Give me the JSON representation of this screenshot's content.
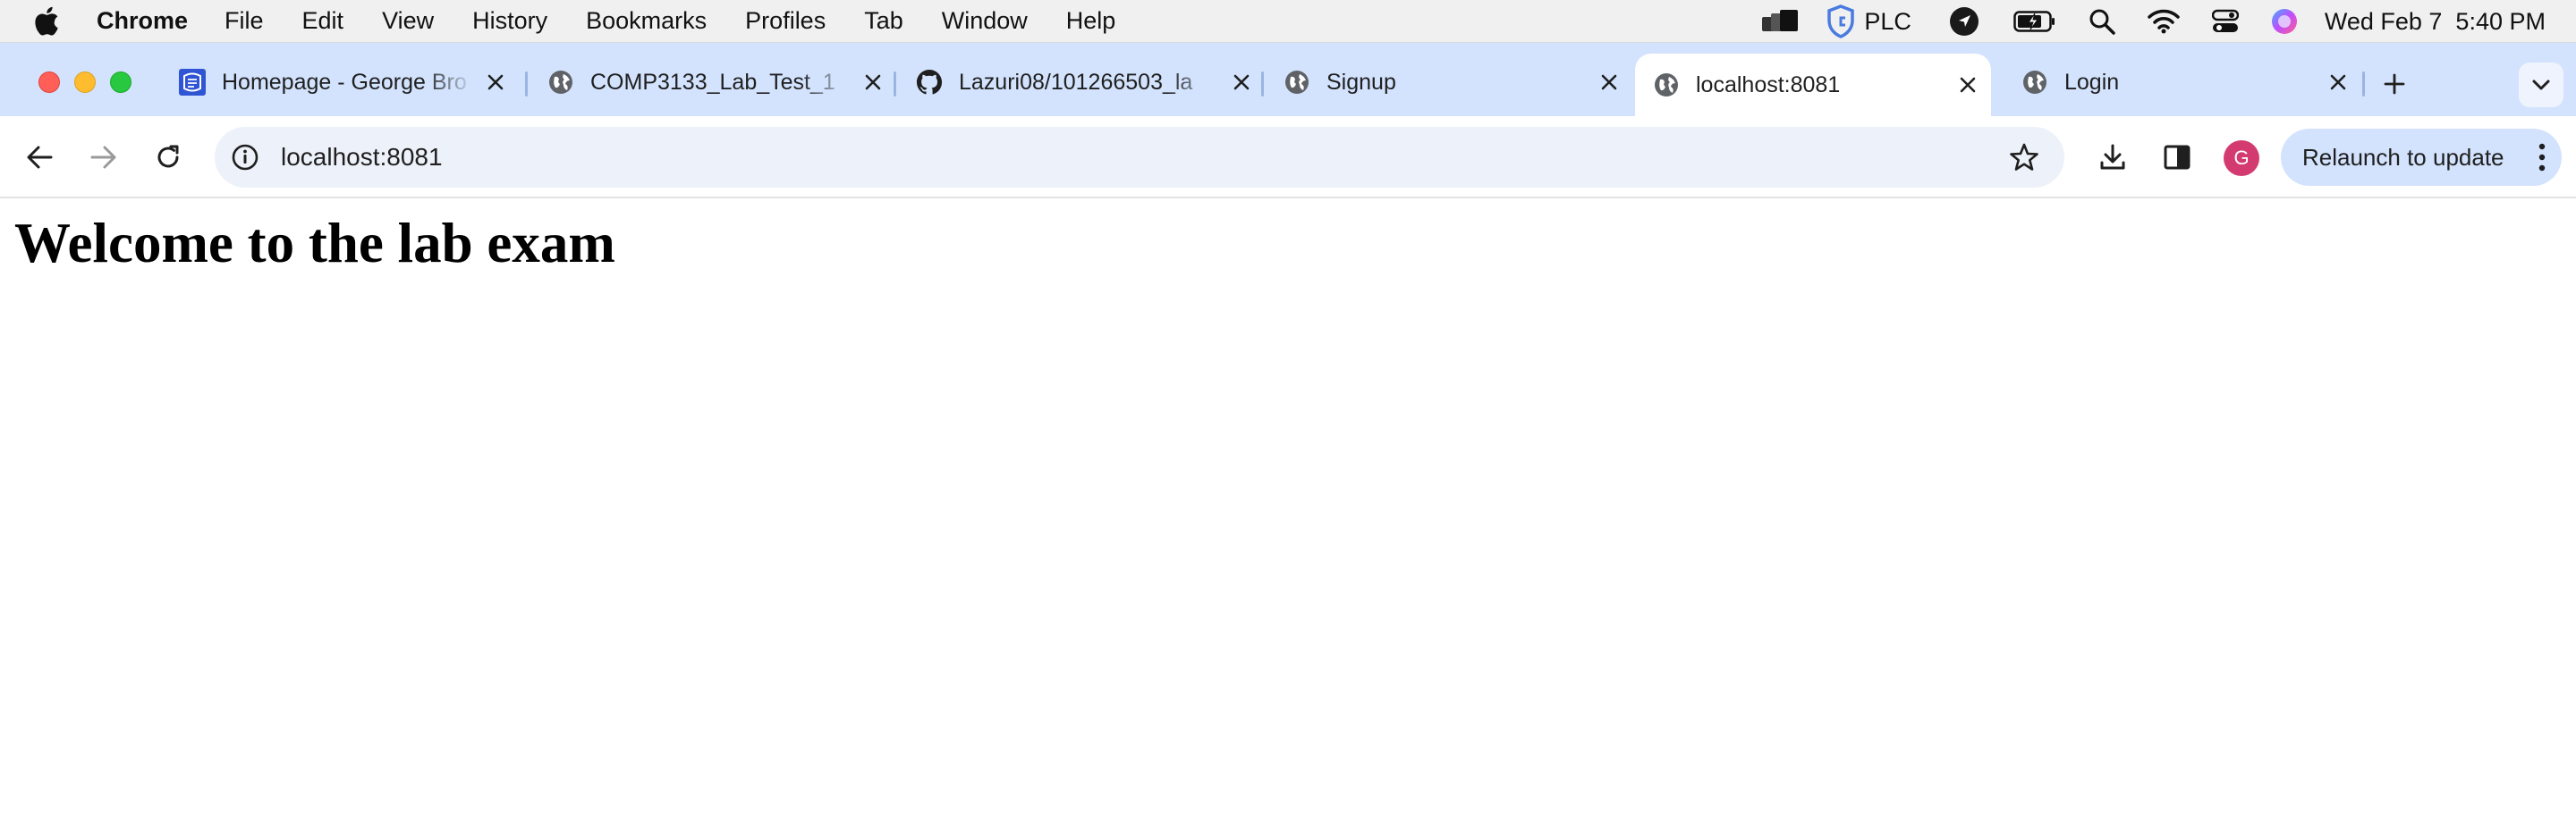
{
  "menubar": {
    "app_name": "Chrome",
    "items": [
      "File",
      "Edit",
      "View",
      "History",
      "Bookmarks",
      "Profiles",
      "Tab",
      "Window",
      "Help"
    ],
    "status": {
      "vpn_label": "PLC",
      "datetime": "Wed Feb 7  5:40 PM"
    }
  },
  "tabs": [
    {
      "title": "Homepage - George Bro",
      "favicon": "college-logo-icon",
      "active": false
    },
    {
      "title": "COMP3133_Lab_Test_1",
      "favicon": "globe-icon",
      "active": false
    },
    {
      "title": "Lazuri08/101266503_la",
      "favicon": "github-icon",
      "active": false
    },
    {
      "title": "Signup",
      "favicon": "globe-icon",
      "active": false
    },
    {
      "title": "localhost:8081",
      "favicon": "globe-icon",
      "active": true
    },
    {
      "title": "Login",
      "favicon": "globe-icon",
      "active": false
    }
  ],
  "toolbar": {
    "url": "localhost:8081",
    "avatar_initial": "G",
    "relaunch_label": "Relaunch to update"
  },
  "page": {
    "heading": "Welcome to the lab exam"
  },
  "colors": {
    "tabstrip_bg": "#d3e3fd",
    "omnibox_bg": "#edf1f9",
    "avatar_bg": "#d33a70",
    "traffic_close": "#ff5f57",
    "traffic_min": "#febc2e",
    "traffic_max": "#28c840"
  }
}
